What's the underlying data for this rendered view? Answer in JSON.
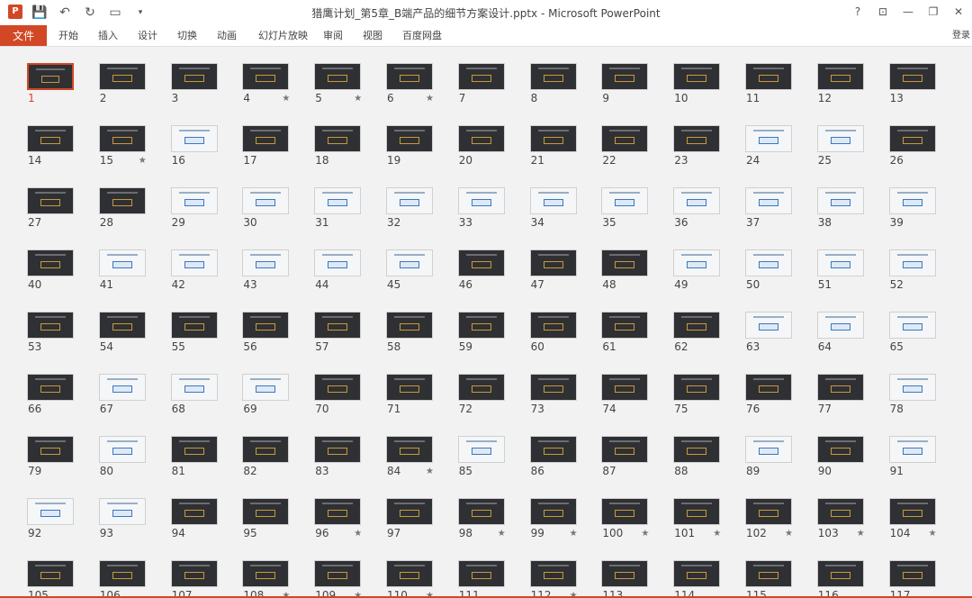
{
  "window": {
    "title": "猎鹰计划_第5章_B端产品的细节方案设计.pptx - Microsoft PowerPoint",
    "help": "?",
    "restore_ribbon": "⊡",
    "minimize": "—",
    "maximize": "❐",
    "close": "✕",
    "signin": "登录",
    "app_icon_letter": "P"
  },
  "qat": {
    "save_icon": "save-icon",
    "undo_icon": "undo-icon",
    "redo_icon": "redo-icon",
    "present_icon": "slideshow-icon",
    "customize_icon": "dropdown-icon"
  },
  "ribbon": {
    "file": "文件",
    "tabs": [
      "开始",
      "插入",
      "设计",
      "切换",
      "动画",
      "幻灯片放映",
      "审阅",
      "视图",
      "百度网盘"
    ]
  },
  "sorter": {
    "selected": "1",
    "slides": [
      {
        "n": "1",
        "star": false
      },
      {
        "n": "2",
        "star": false
      },
      {
        "n": "3",
        "star": false
      },
      {
        "n": "4",
        "star": true
      },
      {
        "n": "5",
        "star": true
      },
      {
        "n": "6",
        "star": true
      },
      {
        "n": "7",
        "star": false
      },
      {
        "n": "8",
        "star": false
      },
      {
        "n": "9",
        "star": false
      },
      {
        "n": "10",
        "star": false
      },
      {
        "n": "11",
        "star": false
      },
      {
        "n": "12",
        "star": false
      },
      {
        "n": "13",
        "star": false
      },
      {
        "n": "14",
        "star": false
      },
      {
        "n": "15",
        "star": true
      },
      {
        "n": "16",
        "star": false
      },
      {
        "n": "17",
        "star": false
      },
      {
        "n": "18",
        "star": false
      },
      {
        "n": "19",
        "star": false
      },
      {
        "n": "20",
        "star": false
      },
      {
        "n": "21",
        "star": false
      },
      {
        "n": "22",
        "star": false
      },
      {
        "n": "23",
        "star": false
      },
      {
        "n": "24",
        "star": false
      },
      {
        "n": "25",
        "star": false
      },
      {
        "n": "26",
        "star": false
      },
      {
        "n": "27",
        "star": false
      },
      {
        "n": "28",
        "star": false
      },
      {
        "n": "29",
        "star": false
      },
      {
        "n": "30",
        "star": false
      },
      {
        "n": "31",
        "star": false
      },
      {
        "n": "32",
        "star": false
      },
      {
        "n": "33",
        "star": false
      },
      {
        "n": "34",
        "star": false
      },
      {
        "n": "35",
        "star": false
      },
      {
        "n": "36",
        "star": false
      },
      {
        "n": "37",
        "star": false
      },
      {
        "n": "38",
        "star": false
      },
      {
        "n": "39",
        "star": false
      },
      {
        "n": "40",
        "star": false
      },
      {
        "n": "41",
        "star": false
      },
      {
        "n": "42",
        "star": false
      },
      {
        "n": "43",
        "star": false
      },
      {
        "n": "44",
        "star": false
      },
      {
        "n": "45",
        "star": false
      },
      {
        "n": "46",
        "star": false
      },
      {
        "n": "47",
        "star": false
      },
      {
        "n": "48",
        "star": false
      },
      {
        "n": "49",
        "star": false
      },
      {
        "n": "50",
        "star": false
      },
      {
        "n": "51",
        "star": false
      },
      {
        "n": "52",
        "star": false
      },
      {
        "n": "53",
        "star": false
      },
      {
        "n": "54",
        "star": false
      },
      {
        "n": "55",
        "star": false
      },
      {
        "n": "56",
        "star": false
      },
      {
        "n": "57",
        "star": false
      },
      {
        "n": "58",
        "star": false
      },
      {
        "n": "59",
        "star": false
      },
      {
        "n": "60",
        "star": false
      },
      {
        "n": "61",
        "star": false
      },
      {
        "n": "62",
        "star": false
      },
      {
        "n": "63",
        "star": false
      },
      {
        "n": "64",
        "star": false
      },
      {
        "n": "65",
        "star": false
      },
      {
        "n": "66",
        "star": false
      },
      {
        "n": "67",
        "star": false
      },
      {
        "n": "68",
        "star": false
      },
      {
        "n": "69",
        "star": false
      },
      {
        "n": "70",
        "star": false
      },
      {
        "n": "71",
        "star": false
      },
      {
        "n": "72",
        "star": false
      },
      {
        "n": "73",
        "star": false
      },
      {
        "n": "74",
        "star": false
      },
      {
        "n": "75",
        "star": false
      },
      {
        "n": "76",
        "star": false
      },
      {
        "n": "77",
        "star": false
      },
      {
        "n": "78",
        "star": false
      },
      {
        "n": "79",
        "star": false
      },
      {
        "n": "80",
        "star": false
      },
      {
        "n": "81",
        "star": false
      },
      {
        "n": "82",
        "star": false
      },
      {
        "n": "83",
        "star": false
      },
      {
        "n": "84",
        "star": true
      },
      {
        "n": "85",
        "star": false
      },
      {
        "n": "86",
        "star": false
      },
      {
        "n": "87",
        "star": false
      },
      {
        "n": "88",
        "star": false
      },
      {
        "n": "89",
        "star": false
      },
      {
        "n": "90",
        "star": false
      },
      {
        "n": "91",
        "star": false
      },
      {
        "n": "92",
        "star": false
      },
      {
        "n": "93",
        "star": false
      },
      {
        "n": "94",
        "star": false
      },
      {
        "n": "95",
        "star": false
      },
      {
        "n": "96",
        "star": true
      },
      {
        "n": "97",
        "star": false
      },
      {
        "n": "98",
        "star": true
      },
      {
        "n": "99",
        "star": true
      },
      {
        "n": "100",
        "star": true
      },
      {
        "n": "101",
        "star": true
      },
      {
        "n": "102",
        "star": true
      },
      {
        "n": "103",
        "star": true
      },
      {
        "n": "104",
        "star": true
      },
      {
        "n": "105",
        "star": false
      },
      {
        "n": "106",
        "star": false
      },
      {
        "n": "107",
        "star": false
      },
      {
        "n": "108",
        "star": true
      },
      {
        "n": "109",
        "star": true
      },
      {
        "n": "110",
        "star": true
      },
      {
        "n": "111",
        "star": false
      },
      {
        "n": "112",
        "star": true
      },
      {
        "n": "113",
        "star": false
      },
      {
        "n": "114",
        "star": false
      },
      {
        "n": "115",
        "star": false
      },
      {
        "n": "116",
        "star": false
      },
      {
        "n": "117",
        "star": false
      }
    ],
    "light_slides": [
      "16",
      "24",
      "25",
      "29",
      "30",
      "31",
      "32",
      "33",
      "34",
      "35",
      "36",
      "37",
      "38",
      "39",
      "41",
      "42",
      "43",
      "44",
      "45",
      "49",
      "50",
      "51",
      "52",
      "63",
      "64",
      "65",
      "67",
      "68",
      "69",
      "78",
      "80",
      "85",
      "89",
      "91",
      "92",
      "93"
    ],
    "star_glyph": "★"
  },
  "colors": {
    "accent": "#d24726",
    "sorter_bg": "#f2f2f2",
    "dark_slide": "#2f3033",
    "light_slide": "#f4f6f8"
  }
}
